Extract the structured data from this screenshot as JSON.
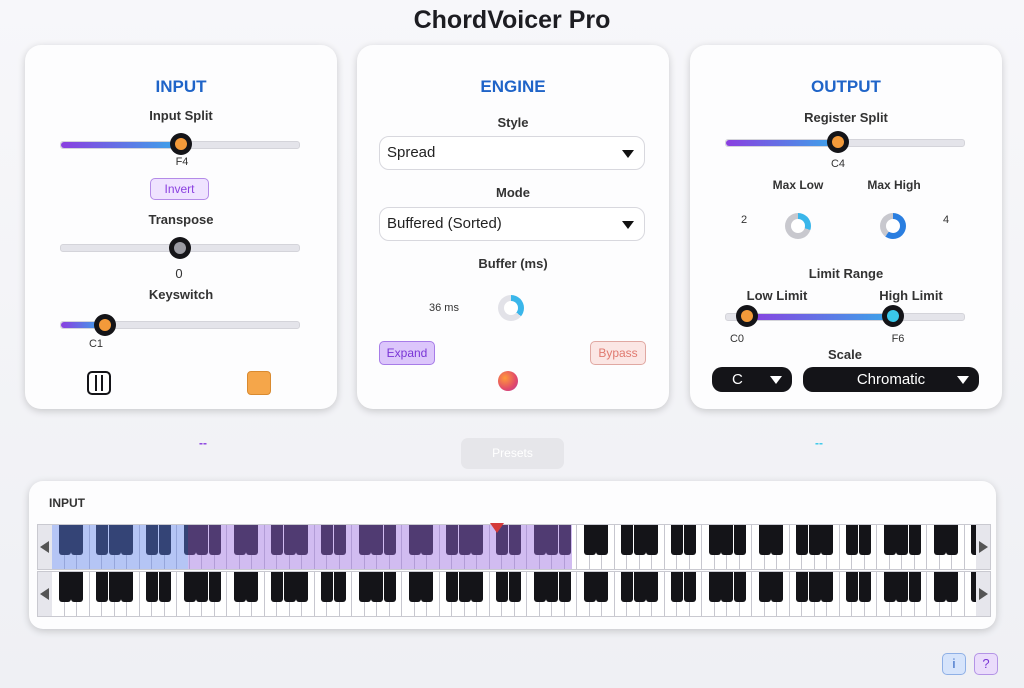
{
  "app": {
    "title": "ChordVoicer Pro"
  },
  "input_panel": {
    "title": "INPUT",
    "input_split": {
      "label": "Input Split",
      "value_label": "F4",
      "fraction": 0.5
    },
    "invert_label": "Invert",
    "transpose": {
      "label": "Transpose",
      "value_label": "0",
      "fraction": 0.5
    },
    "keyswitch": {
      "label": "Keyswitch",
      "value_label": "C1",
      "fraction": 0.18
    },
    "icons": [
      "piano-keys-icon",
      "orange-square-icon"
    ]
  },
  "engine_panel": {
    "title": "ENGINE",
    "style": {
      "label": "Style",
      "selected": "Spread"
    },
    "mode": {
      "label": "Mode",
      "selected": "Buffered (Sorted)"
    },
    "buffer": {
      "label": "Buffer (ms)",
      "value_label": "36 ms",
      "fraction": 0.36
    },
    "expand_label": "Expand",
    "bypass_label": "Bypass"
  },
  "output_panel": {
    "title": "OUTPUT",
    "register_split": {
      "label": "Register Split",
      "value_label": "C4",
      "fraction": 0.47
    },
    "max_low": {
      "label": "Max Low",
      "value": "2",
      "fraction": 0.3
    },
    "max_high": {
      "label": "Max High",
      "value": "4",
      "fraction": 0.6
    },
    "limit_range": {
      "label": "Limit Range",
      "low_label": "Low Limit",
      "high_label": "High Limit",
      "low_value": "C0",
      "high_value": "F6",
      "low_fraction": 0.09,
      "high_fraction": 0.69
    },
    "scale": {
      "label": "Scale",
      "root": "C",
      "type": "Chromatic"
    }
  },
  "indicators": {
    "left_dash": "--",
    "right_dash": "--"
  },
  "presets_label": "Presets",
  "keyboard": {
    "title": "INPUT"
  },
  "footer": {
    "info_label": "i",
    "help_label": "?"
  },
  "colors": {
    "accent_blue": "#1f64c8",
    "orange": "#f39a3a",
    "purple": "#8a3fe0",
    "cyan": "#3ac8ea"
  }
}
